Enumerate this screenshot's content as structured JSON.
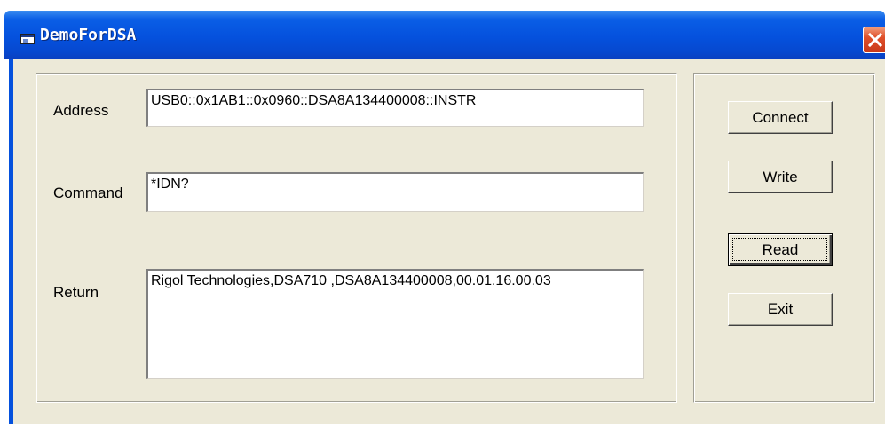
{
  "window": {
    "title": "DemoForDSA"
  },
  "form": {
    "address_label": "Address",
    "address_value": "USB0::0x1AB1::0x0960::DSA8A134400008::INSTR",
    "command_label": "Command",
    "command_value": "*IDN?",
    "return_label": "Return",
    "return_value": "Rigol Technologies,DSA710 ,DSA8A134400008,00.01.16.00.03"
  },
  "buttons": {
    "connect": "Connect",
    "write": "Write",
    "read": "Read",
    "exit": "Exit"
  },
  "icons": {
    "app": "app-window-icon",
    "close": "close-icon"
  },
  "colors": {
    "titlebar": "#0551dd",
    "close_button": "#e0502a",
    "client_background": "#ece9d8"
  }
}
